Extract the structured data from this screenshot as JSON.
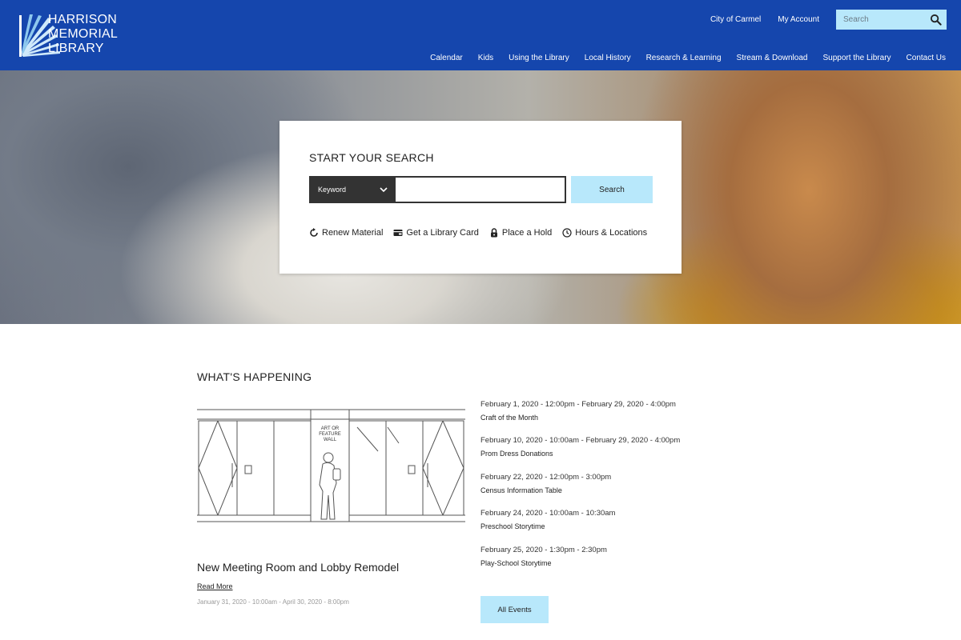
{
  "header": {
    "logo": {
      "line1": "HARRISON",
      "line2": "MEMORIAL",
      "line3": "LIBRARY"
    },
    "utility_links": [
      "City of Carmel",
      "My Account"
    ],
    "search": {
      "placeholder": "Search",
      "icon": "search-icon"
    },
    "nav": [
      "Calendar",
      "Kids",
      "Using the Library",
      "Local History",
      "Research & Learning",
      "Stream & Download",
      "Support the Library",
      "Contact Us"
    ],
    "brand_color": "#1546ad"
  },
  "hero": {
    "card": {
      "title": "START YOUR SEARCH",
      "search_type": "Keyword",
      "query": "",
      "search_button": "Search",
      "quick_links": [
        {
          "label": "Renew Material",
          "icon": "renew-icon"
        },
        {
          "label": "Get a Library Card",
          "icon": "card-icon"
        },
        {
          "label": "Place a Hold",
          "icon": "lock-icon"
        },
        {
          "label": "Hours & Locations",
          "icon": "clock-icon"
        }
      ]
    }
  },
  "whats_happening": {
    "title": "WHAT'S HAPPENING",
    "feature": {
      "image_label": [
        "ART OR",
        "FEATURE",
        "WALL"
      ],
      "title": "New Meeting Room and Lobby Remodel",
      "read_more": "Read More",
      "date": "January 31, 2020 - 10:00am - April 30, 2020 - 8:00pm"
    },
    "events": [
      {
        "date": "February 1, 2020 - 12:00pm - February 29, 2020 - 4:00pm",
        "title": "Craft of the Month"
      },
      {
        "date": "February 10, 2020 - 10:00am - February 29, 2020 - 4:00pm",
        "title": "Prom Dress Donations"
      },
      {
        "date": "February 22, 2020 - 12:00pm - 3:00pm",
        "title": "Census Information Table"
      },
      {
        "date": "February 24, 2020 - 10:00am - 10:30am",
        "title": "Preschool Storytime"
      },
      {
        "date": "February 25, 2020 - 1:30pm - 2:30pm",
        "title": "Play-School Storytime"
      }
    ],
    "all_events": "All Events"
  },
  "colors": {
    "accent_light": "#b8e8fb",
    "dark": "#333333"
  }
}
